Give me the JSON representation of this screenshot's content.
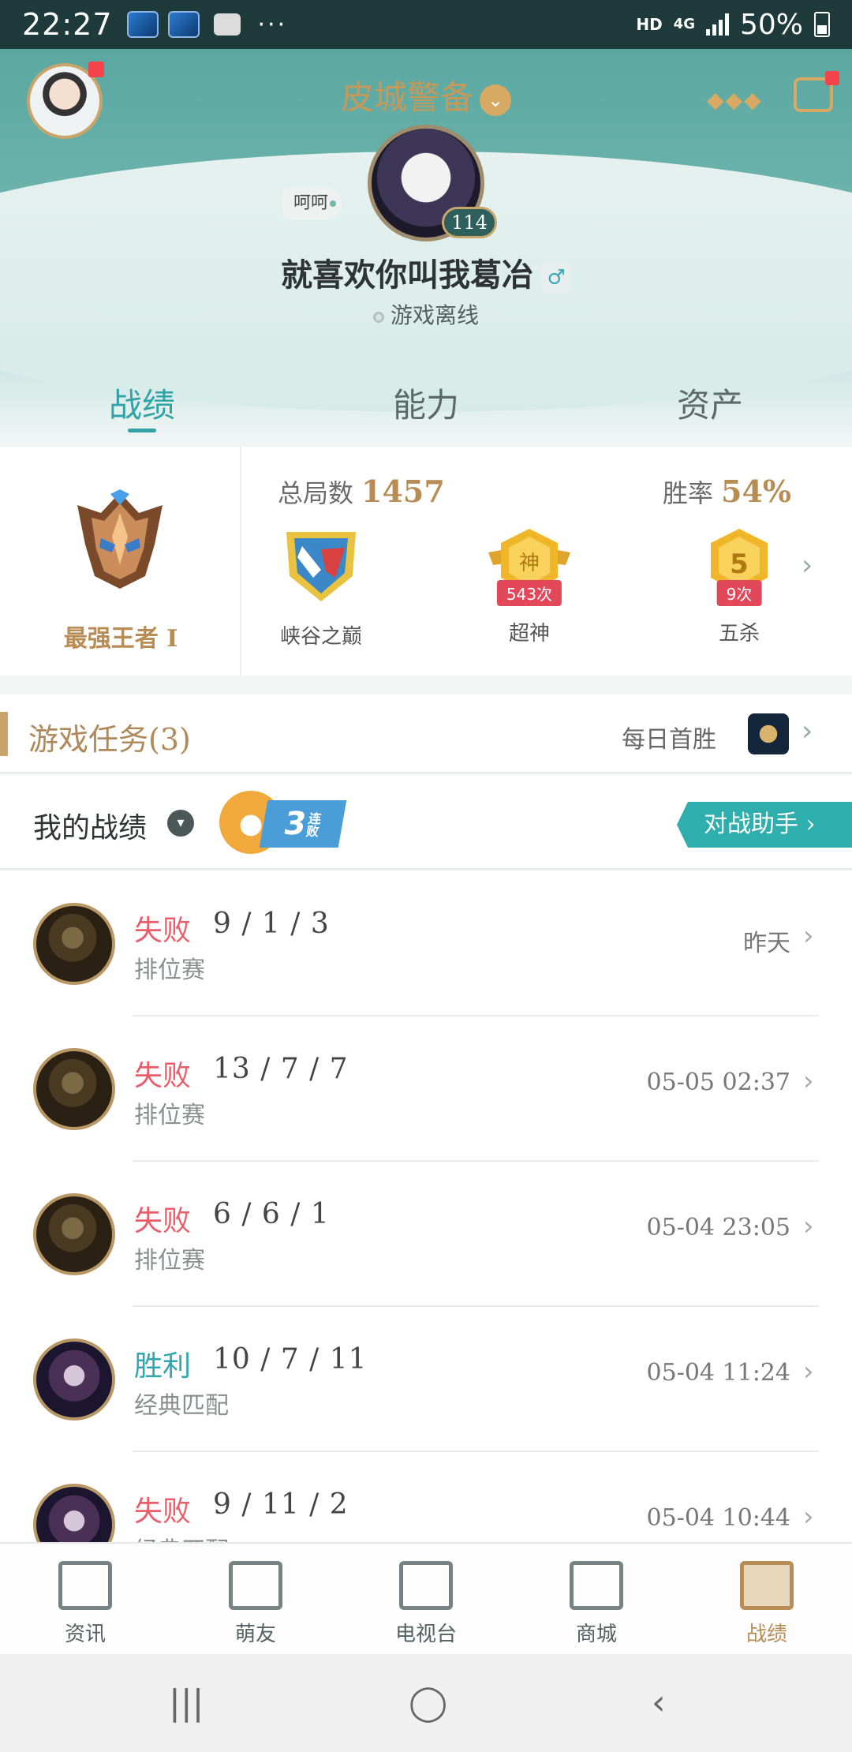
{
  "statusbar": {
    "time": "22:27",
    "dots": "···",
    "hd": "HD",
    "net": "4G",
    "battery": "50%"
  },
  "header": {
    "server": "皮城警备",
    "more": "◆◆◆",
    "club_tag": "呵呵",
    "level": "114",
    "nickname": "就喜欢你叫我葛冶",
    "gender": "♂",
    "state": "游戏离线"
  },
  "tabs": [
    "战绩",
    "能力",
    "资产"
  ],
  "stats": {
    "rank_name": "最强王者 I",
    "total_games_label": "总局数",
    "total_games": "1457",
    "win_rate_label": "胜率",
    "win_rate": "54%",
    "badges": [
      {
        "label": "峡谷之巅",
        "count": ""
      },
      {
        "label": "超神",
        "count": "543次"
      },
      {
        "label": "五杀",
        "count": "9次"
      }
    ]
  },
  "tasks": {
    "title": "游戏任务(3)",
    "daily": "每日首胜"
  },
  "myrecord": {
    "title": "我的战绩",
    "streak_num": "3",
    "streak_text": "连败",
    "assistant": "对战助手 ›"
  },
  "matches": [
    {
      "result": "失败",
      "type": "lose",
      "kda": "9 / 1 / 3",
      "mode": "排位赛",
      "time": "昨天"
    },
    {
      "result": "失败",
      "type": "lose",
      "kda": "13 / 7 / 7",
      "mode": "排位赛",
      "time": "05-05 02:37"
    },
    {
      "result": "失败",
      "type": "lose",
      "kda": "6 / 6 / 1",
      "mode": "排位赛",
      "time": "05-04 23:05"
    },
    {
      "result": "胜利",
      "type": "win",
      "kda": "10 / 7 / 11",
      "mode": "经典匹配",
      "time": "05-04 11:24"
    },
    {
      "result": "失败",
      "type": "lose",
      "kda": "9 / 11 / 2",
      "mode": "经典匹配",
      "time": "05-04 10:44"
    }
  ],
  "bottomnav": [
    "资讯",
    "萌友",
    "电视台",
    "商城",
    "战绩"
  ],
  "sysnav": {
    "recent": "|||",
    "home": "◯",
    "back": "‹"
  },
  "colors": {
    "accent": "#31a3a7",
    "gold": "#b88d55",
    "lose": "#ea5e6a",
    "win": "#2fa7ad"
  }
}
